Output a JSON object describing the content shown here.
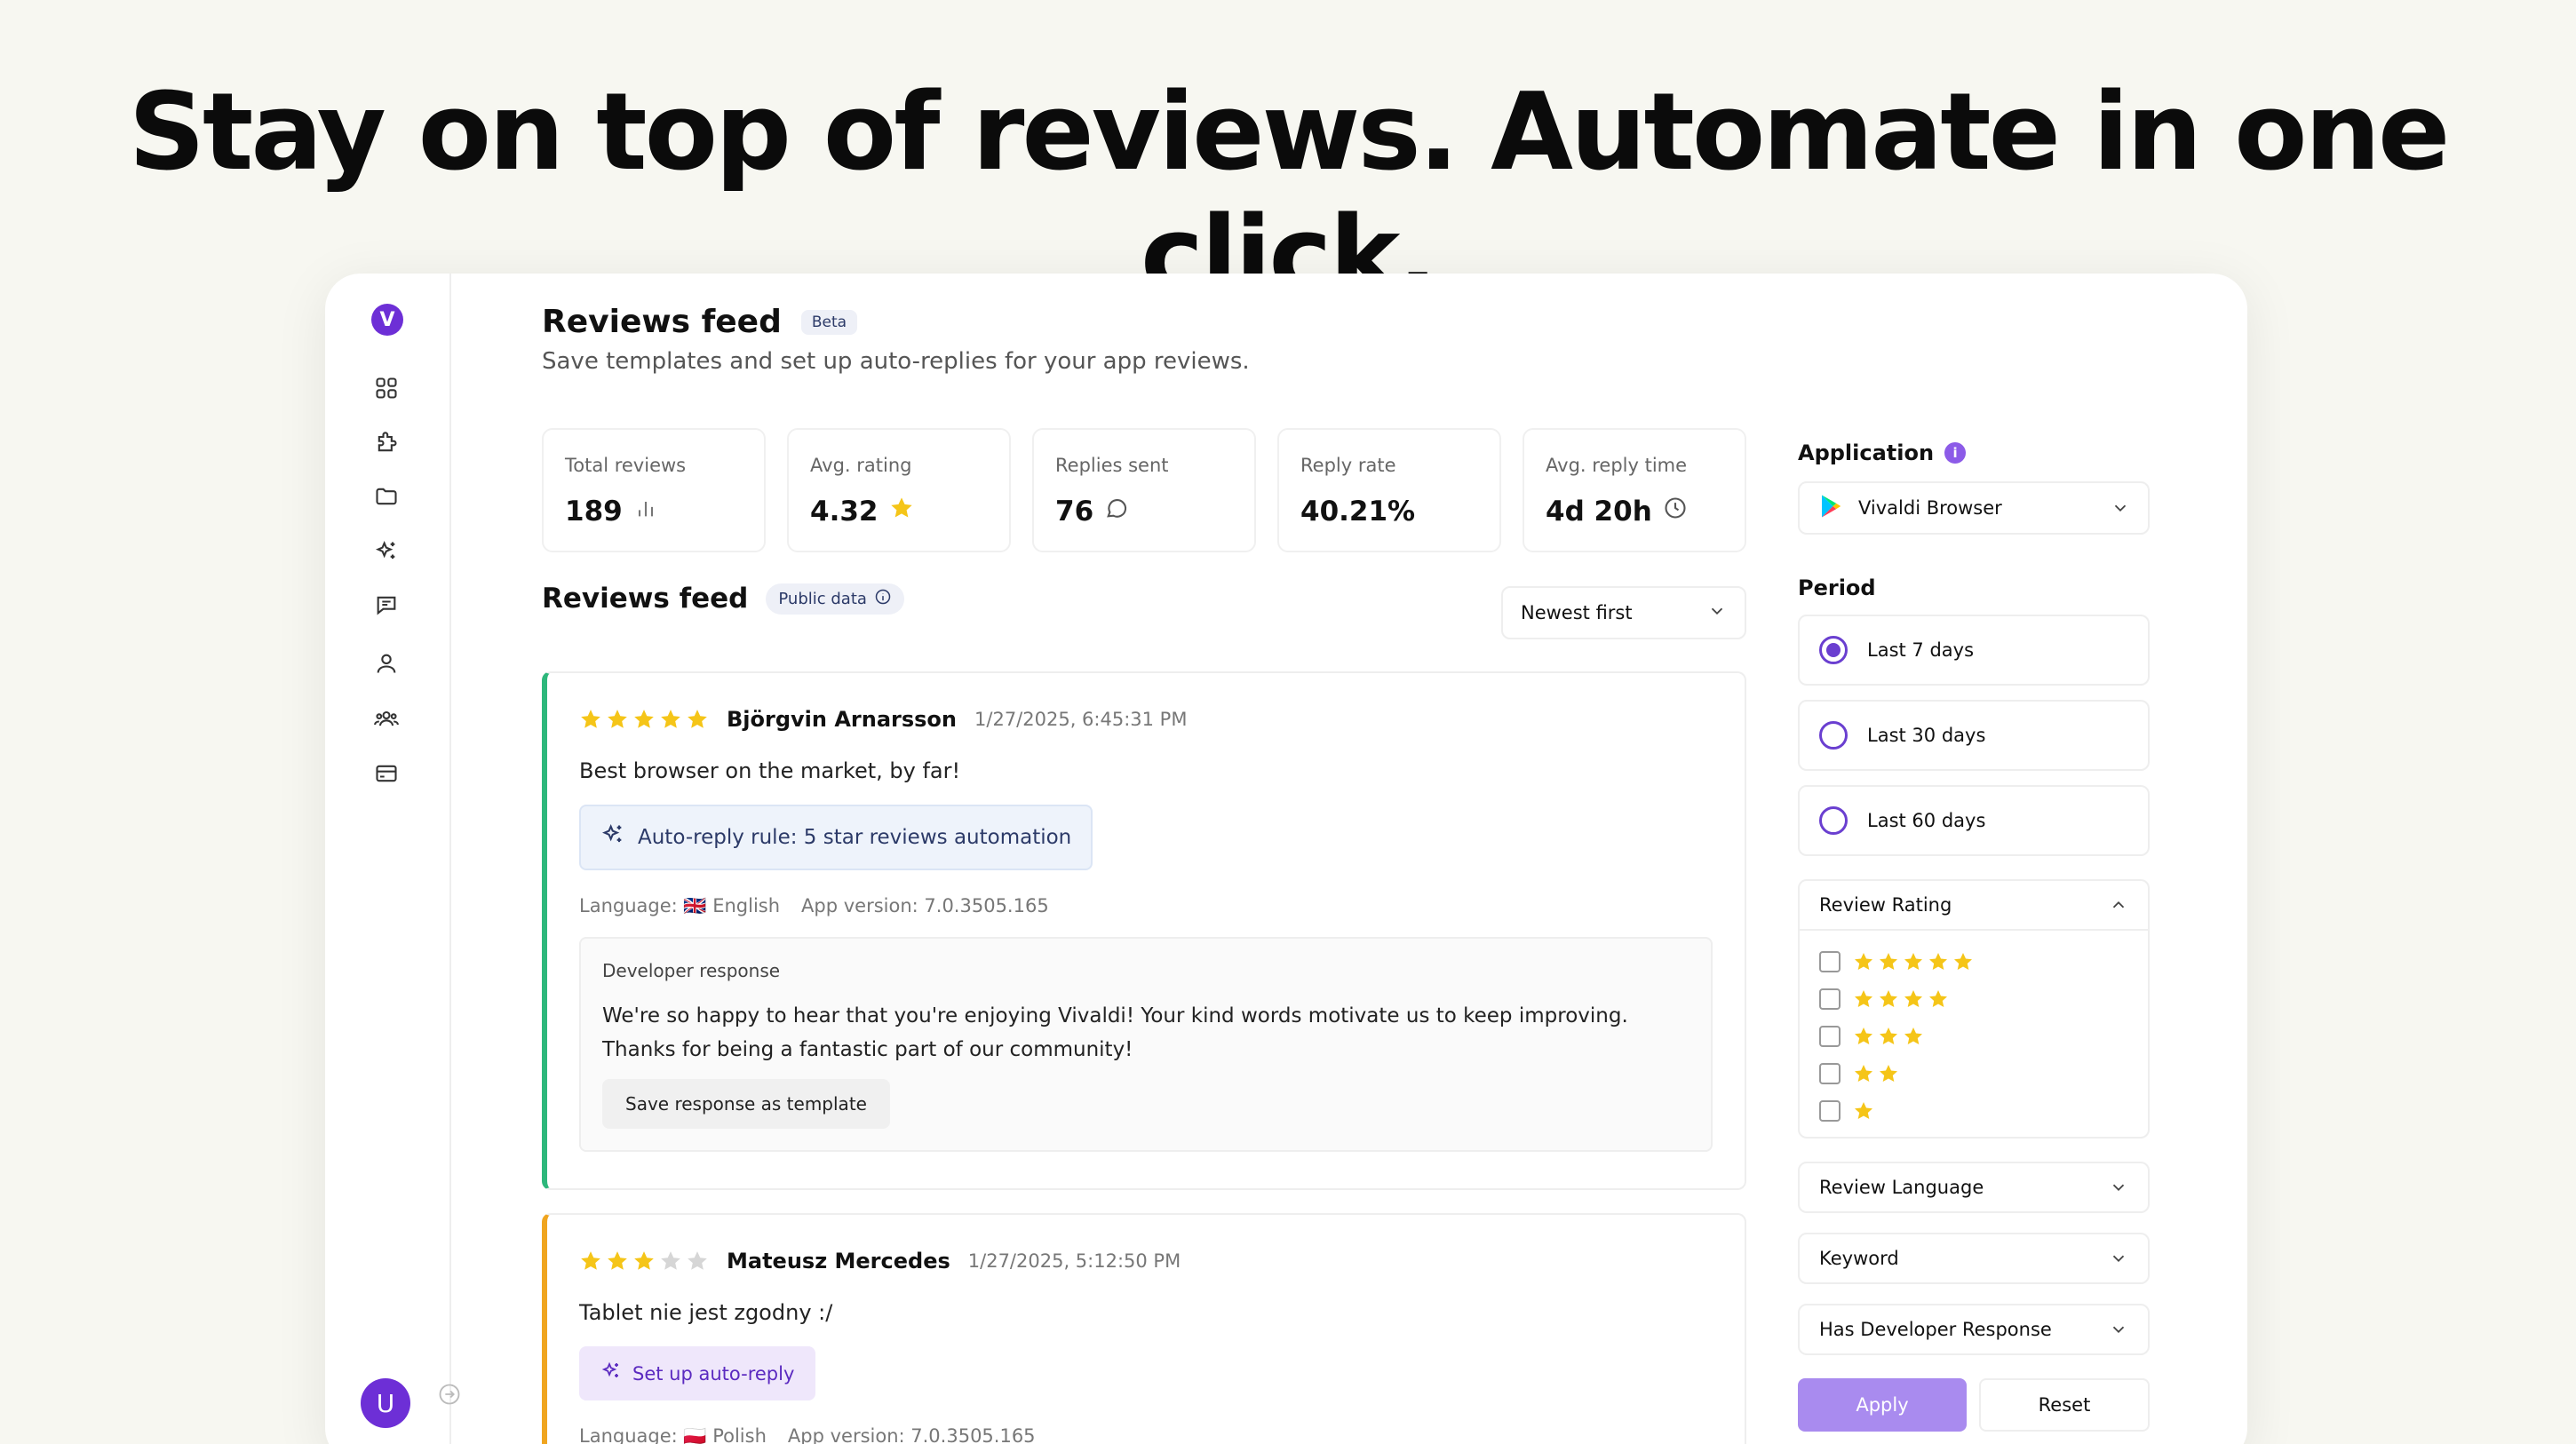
{
  "headline": "Stay on top of reviews. Automate in one click.",
  "brand": {
    "logo_letter": "V",
    "user_initial": "U",
    "accent": "#6d2fd6"
  },
  "sidebar": {
    "icons": [
      "dashboard-icon",
      "puzzle-icon",
      "folder-icon",
      "sparkles-icon",
      "chat-icon",
      "user-icon",
      "team-icon",
      "credit-card-icon"
    ]
  },
  "header": {
    "title": "Reviews feed",
    "badge": "Beta",
    "subtitle": "Save templates and set up auto-replies for your app reviews."
  },
  "stats": [
    {
      "label": "Total reviews",
      "value": "189",
      "icon": "bar-chart-icon"
    },
    {
      "label": "Avg. rating",
      "value": "4.32",
      "icon": "star-icon"
    },
    {
      "label": "Replies sent",
      "value": "76",
      "icon": "chat-bubble-icon"
    },
    {
      "label": "Reply rate",
      "value": "40.21%",
      "icon": ""
    },
    {
      "label": "Avg. reply time",
      "value": "4d 20h",
      "icon": "clock-icon"
    }
  ],
  "feed": {
    "title": "Reviews feed",
    "public_badge": "Public data",
    "sort_value": "Newest first"
  },
  "reviews": [
    {
      "stars": 5,
      "author": "Björgvin Arnarsson",
      "date": "1/27/2025, 6:45:31 PM",
      "text": "Best browser on the market, by far!",
      "rule": "Auto-reply rule: 5 star reviews automation",
      "language": "Language: 🇬🇧 English",
      "version": "App version: 7.0.3505.165",
      "dev_label": "Developer response",
      "dev_text": "We're so happy to hear that you're enjoying Vivaldi! Your kind words motivate us to keep improving. Thanks for being a fantastic part of our community!",
      "save_label": "Save response as template"
    },
    {
      "stars": 3,
      "author": "Mateusz Mercedes",
      "date": "1/27/2025, 5:12:50 PM",
      "text": "Tablet nie jest zgodny :/",
      "setup": "Set up auto-reply",
      "language": "Language: 🇵🇱 Polish",
      "version": "App version: 7.0.3505.165"
    }
  ],
  "filters": {
    "application_label": "Application",
    "application_value": "Vivaldi Browser",
    "period_label": "Period",
    "periods": [
      {
        "label": "Last 7 days",
        "selected": true
      },
      {
        "label": "Last 30 days",
        "selected": false
      },
      {
        "label": "Last 60 days",
        "selected": false
      }
    ],
    "rating_label": "Review Rating",
    "rating_options": [
      5,
      4,
      3,
      2,
      1
    ],
    "language_label": "Review Language",
    "keyword_label": "Keyword",
    "dev_response_label": "Has Developer Response",
    "apply_label": "Apply",
    "reset_label": "Reset"
  },
  "colors": {
    "star": "#f5c518",
    "star_empty": "#d6d6d6",
    "green_bar": "#2db77b",
    "orange_bar": "#f0a51f"
  }
}
